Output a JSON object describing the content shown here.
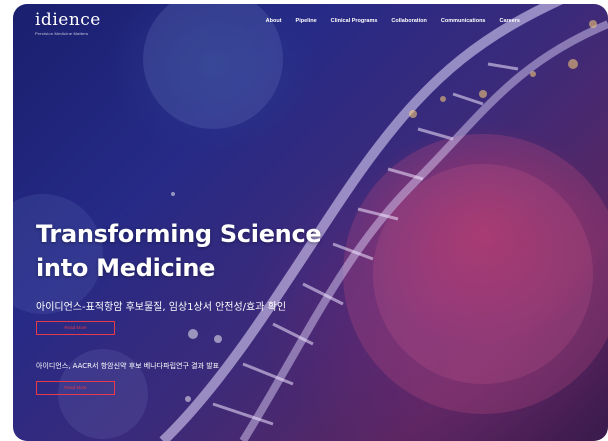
{
  "brand": {
    "name": "idience",
    "tagline": "Precision Medicine Matters"
  },
  "nav": {
    "items": [
      "About",
      "Pipeline",
      "Clinical Programs",
      "Collaboration",
      "Communications",
      "Careers"
    ]
  },
  "hero": {
    "headline_line1": "Transforming Science",
    "headline_line2": "into Medicine",
    "news1": "아이디언스-표적항암 후보물질, 임상1상서 안전성/효과 확인",
    "button1_label": "Read More",
    "news2": "아이디언스, AACR서 항암신약 후보 베나다파립연구 결과 발표",
    "button2_label": "Read More"
  },
  "colors": {
    "accent": "#e53a4a",
    "background_dark": "#1a1f6e"
  }
}
